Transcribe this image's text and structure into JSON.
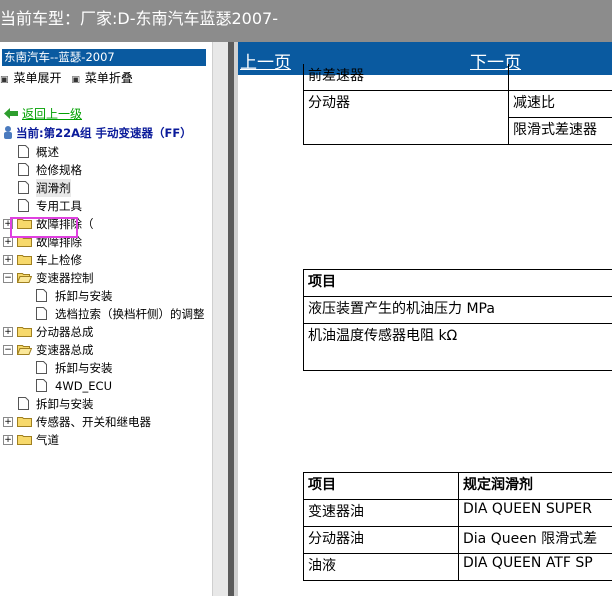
{
  "window": {
    "title": "当前车型：厂家:D-东南汽车蓝瑟2007-"
  },
  "sidebar": {
    "brand": "东南汽车--蓝瑟-2007",
    "expand_all": "菜单展开",
    "collapse_all": "菜单折叠",
    "back": "返回上一级",
    "current": "当前:第22A组 手动变速器（FF）",
    "tree": [
      {
        "label": "概述",
        "type": "doc",
        "level": 1
      },
      {
        "label": "检修规格",
        "type": "doc",
        "level": 1
      },
      {
        "label": "润滑剂",
        "type": "doc",
        "level": 1,
        "selected": true
      },
      {
        "label": "专用工具",
        "type": "doc",
        "level": 1
      },
      {
        "label": "故障排除（",
        "type": "folder",
        "level": 1,
        "expanded": false
      },
      {
        "label": "故障排除",
        "type": "folder",
        "level": 1,
        "expanded": false
      },
      {
        "label": "车上检修",
        "type": "folder",
        "level": 1,
        "expanded": false
      },
      {
        "label": "变速器控制",
        "type": "folder",
        "level": 1,
        "expanded": true
      },
      {
        "label": "拆卸与安装",
        "type": "doc",
        "level": 2
      },
      {
        "label": "选档拉索（换档杆侧）的调整",
        "type": "doc",
        "level": 2
      },
      {
        "label": "分动器总成",
        "type": "folder",
        "level": 1,
        "expanded": false
      },
      {
        "label": "变速器总成",
        "type": "folder",
        "level": 1,
        "expanded": true
      },
      {
        "label": "拆卸与安装",
        "type": "doc",
        "level": 2
      },
      {
        "label": "4WD_ECU",
        "type": "doc",
        "level": 2
      },
      {
        "label": "拆卸与安装",
        "type": "doc",
        "level": 1
      },
      {
        "label": "传感器、开关和继电器",
        "type": "folder",
        "level": 1,
        "expanded": false
      },
      {
        "label": "气道",
        "type": "folder",
        "level": 1,
        "expanded": false
      }
    ]
  },
  "nav": {
    "prev": "上一页",
    "next": "下一页"
  },
  "content": {
    "table1": {
      "rows": [
        [
          "前差速器",
          ""
        ],
        [
          "分动器",
          "减速比"
        ],
        [
          "",
          "限滑式差速器"
        ]
      ]
    },
    "table2": {
      "header": "项目",
      "rows": [
        "液压装置产生的机油压力 MPa",
        "机油温度传感器电阻 kΩ"
      ]
    },
    "table3": {
      "headers": [
        "项目",
        "规定润滑剂"
      ],
      "rows": [
        [
          "变速器油",
          "DIA QUEEN SUPER"
        ],
        [
          "分动器油",
          "Dia Queen 限滑式差"
        ],
        [
          "油液",
          "DIA QUEEN ATF SP"
        ]
      ]
    }
  },
  "colors": {
    "titlebar": "#8c8c8c",
    "brand": "#0a5aa0",
    "nav": "#0a5aa0",
    "highlight": "#e040e0",
    "back_link": "#00a000",
    "current": "#0a1a9a"
  }
}
